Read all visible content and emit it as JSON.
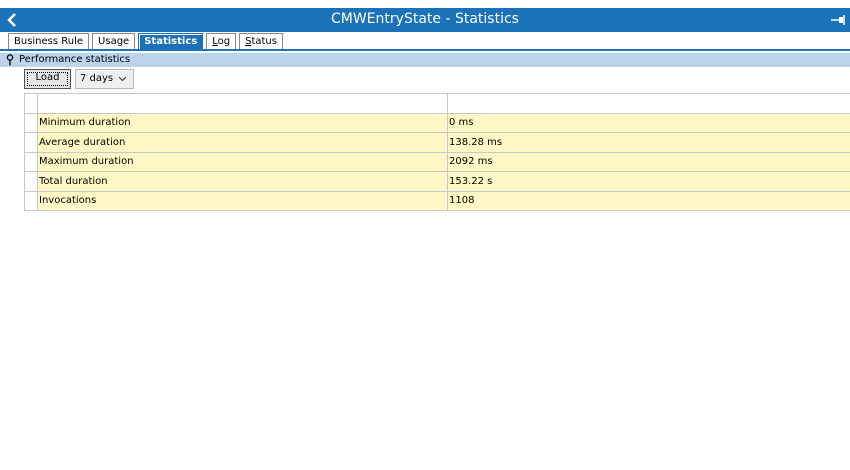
{
  "window": {
    "title": "CMWEntryState - Statistics",
    "back_icon": "chevron-left-icon",
    "pin_icon": "pin-right-icon",
    "accent_color": "#1c72b8"
  },
  "tabs": [
    {
      "label": "Business Rule",
      "active": false
    },
    {
      "label": "Usage",
      "active": false
    },
    {
      "label": "Statistics",
      "active": true
    },
    {
      "label": "Log",
      "active": false,
      "mnemonic": "L",
      "rest": "og"
    },
    {
      "label": "Status",
      "active": false,
      "mnemonic": "S",
      "rest": "tatus"
    }
  ],
  "section": {
    "title": "Performance statistics",
    "icon": "pin-icon",
    "header_color": "#bcd3ec"
  },
  "toolbar": {
    "load_label": "Load",
    "period_value": "7 days"
  },
  "stats": {
    "rows": [
      {
        "label": "Minimum duration",
        "value": "0 ms"
      },
      {
        "label": "Average duration",
        "value": "138.28 ms"
      },
      {
        "label": "Maximum duration",
        "value": "2092 ms"
      },
      {
        "label": "Total duration",
        "value": "153.22 s"
      },
      {
        "label": "Invocations",
        "value": "1108"
      }
    ],
    "row_color": "#fff8c6"
  }
}
